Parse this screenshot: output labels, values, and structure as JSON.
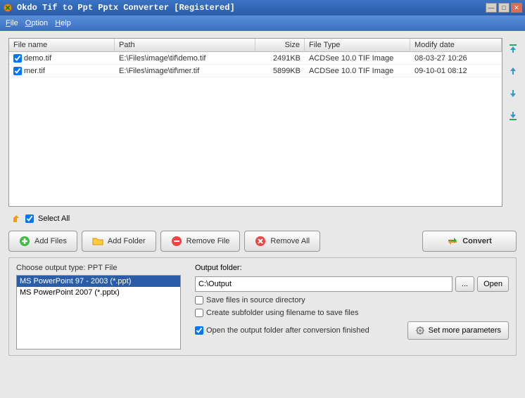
{
  "window": {
    "title": "Okdo Tif to Ppt Pptx Converter [Registered]"
  },
  "menu": {
    "file": "File",
    "option": "Option",
    "help": "Help"
  },
  "table": {
    "headers": {
      "name": "File name",
      "path": "Path",
      "size": "Size",
      "type": "File Type",
      "date": "Modify date"
    },
    "rows": [
      {
        "name": "demo.tif",
        "path": "E:\\Files\\image\\tif\\demo.tif",
        "size": "2491KB",
        "type": "ACDSee 10.0 TIF Image",
        "date": "08-03-27 10:26"
      },
      {
        "name": "mer.tif",
        "path": "E:\\Files\\image\\tif\\mer.tif",
        "size": "5899KB",
        "type": "ACDSee 10.0 TIF Image",
        "date": "09-10-01 08:12"
      }
    ]
  },
  "selectall": "Select All",
  "buttons": {
    "addFiles": "Add Files",
    "addFolder": "Add Folder",
    "removeFile": "Remove File",
    "removeAll": "Remove All",
    "convert": "Convert"
  },
  "outputType": {
    "label": "Choose output type:  PPT File",
    "items": [
      "MS PowerPoint 97 - 2003 (*.ppt)",
      "MS PowerPoint 2007 (*.pptx)"
    ]
  },
  "outputFolder": {
    "label": "Output folder:",
    "value": "C:\\Output",
    "browse": "...",
    "open": "Open"
  },
  "options": {
    "saveInSource": "Save files in source directory",
    "createSubfolder": "Create subfolder using filename to save files",
    "openAfter": "Open the output folder after conversion finished"
  },
  "params": "Set more parameters"
}
